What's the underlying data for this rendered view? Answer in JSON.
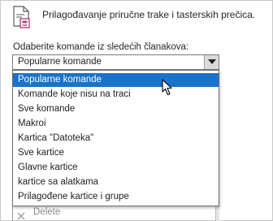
{
  "header": {
    "title": "Prilagođavanje priručne trake i tasterskih prečica.",
    "icon": "customize-ribbon-icon"
  },
  "commands": {
    "label": "Odaberite komande iz sledećih članakova:",
    "selected_value": "Popularne komande",
    "options": [
      "Popularne komande",
      "Komande koje nisu na traci",
      "Sve komande",
      "Makroi",
      "Kartica \"Datoteka\"",
      "Sve kartice",
      "Glavne kartice",
      "kartice sa alatkama",
      "Prilagođene kartice i grupe"
    ],
    "highlighted_index": 0
  },
  "background_list": {
    "partial_item": "Delete"
  },
  "colors": {
    "highlight": "#1a73c8",
    "icon_accent": "#b5467a"
  }
}
